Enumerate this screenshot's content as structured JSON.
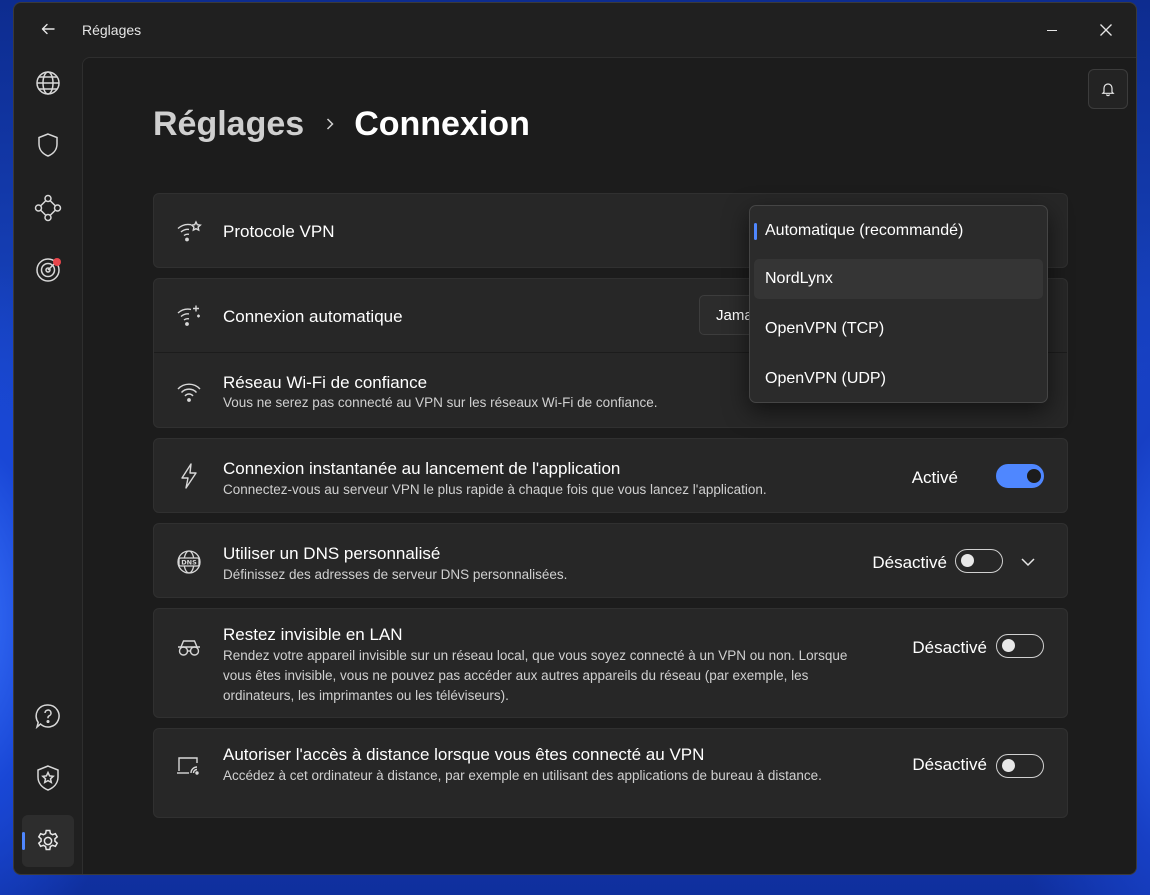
{
  "window": {
    "title": "Réglages"
  },
  "breadcrumb": {
    "parent": "Réglages",
    "current": "Connexion"
  },
  "sidebar": {
    "items": [
      {
        "name": "globe-icon",
        "label": ""
      },
      {
        "name": "shield-icon",
        "label": ""
      },
      {
        "name": "meshnet-icon",
        "label": ""
      },
      {
        "name": "target-icon",
        "label": ""
      },
      {
        "name": "help-icon",
        "label": ""
      },
      {
        "name": "star-shield-icon",
        "label": ""
      },
      {
        "name": "gear-icon",
        "label": ""
      }
    ]
  },
  "settings": {
    "protocol": {
      "title": "Protocole VPN",
      "selected": "Automatique (recommandé)"
    },
    "autoconnect": {
      "title": "Connexion automatique",
      "value": "Jamais"
    },
    "trusted_wifi": {
      "title": "Réseau Wi-Fi de confiance",
      "desc": "Vous ne serez pas connecté au VPN sur les réseaux Wi-Fi de confiance."
    },
    "instant_connect": {
      "title": "Connexion instantanée au lancement de l'application",
      "desc": "Connectez-vous au serveur VPN le plus rapide à chaque fois que vous lancez l'application.",
      "state": "Activé"
    },
    "custom_dns": {
      "title": "Utiliser un DNS personnalisé",
      "desc": "Définissez des adresses de serveur DNS personnalisées.",
      "state": "Désactivé"
    },
    "lan_invisible": {
      "title": "Restez invisible en LAN",
      "desc": "Rendez votre appareil invisible sur un réseau local, que vous soyez connecté à un VPN ou non. Lorsque vous êtes invisible, vous ne pouvez pas accéder aux autres appareils du réseau (par exemple, les ordinateurs, les imprimantes ou les téléviseurs).",
      "state": "Désactivé"
    },
    "remote_access": {
      "title": "Autoriser l'accès à distance lorsque vous êtes connecté au VPN",
      "desc": "Accédez à cet ordinateur à distance, par exemple en utilisant des applications de bureau à distance.",
      "state": "Désactivé"
    }
  },
  "dropdown": {
    "options": [
      "Automatique (recommandé)",
      "NordLynx",
      "OpenVPN (TCP)",
      "OpenVPN (UDP)"
    ],
    "selected_index": 0,
    "hover_index": 1
  },
  "colors": {
    "accent": "#4f87ff",
    "badge": "#e8464c",
    "window_bg": "#202020",
    "card_bg": "#272727"
  }
}
